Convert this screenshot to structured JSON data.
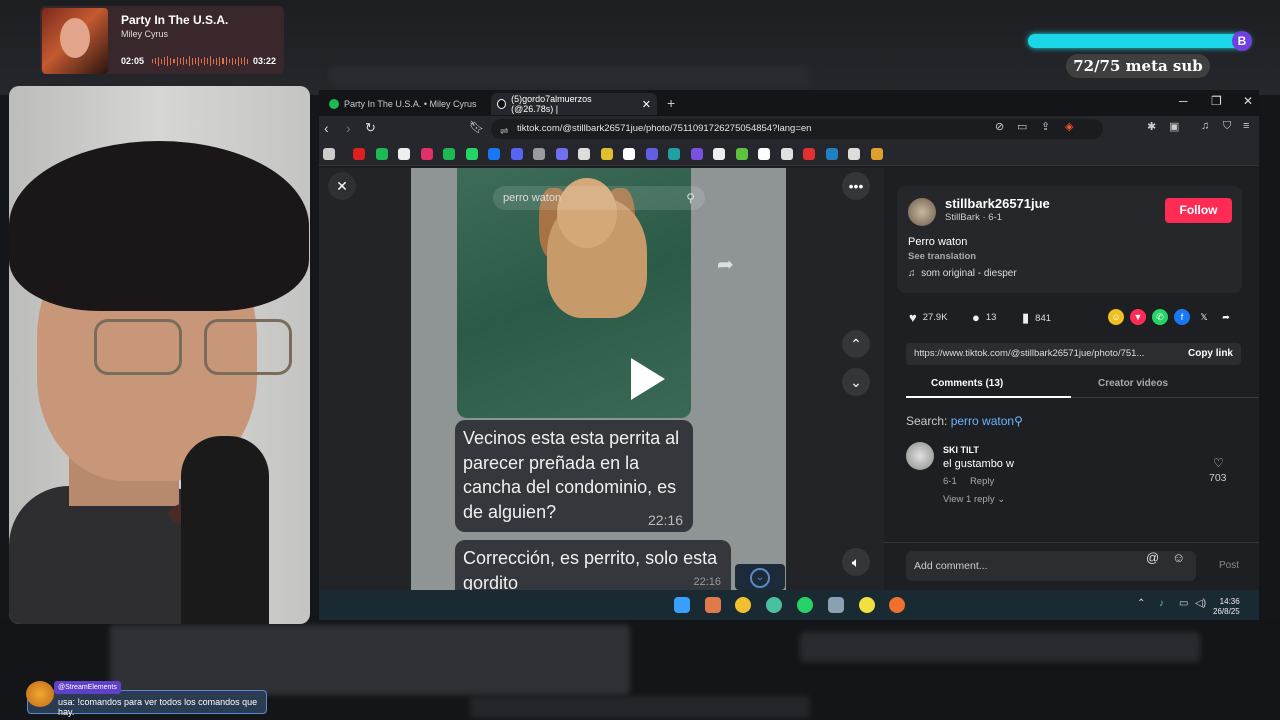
{
  "music": {
    "song": "Party In The U.S.A.",
    "artist": "Miley Cyrus",
    "elapsed": "02:05",
    "duration": "03:22"
  },
  "goal": {
    "label": "72/75 meta sub",
    "badge": "B",
    "progress": 0.96
  },
  "browser": {
    "tabs": [
      {
        "label": "Party In The U.S.A. • Miley Cyrus",
        "active": false
      },
      {
        "label": "(5)gordo7almuerzos (@26.78s) |",
        "active": true
      }
    ],
    "url": "tiktok.com/@stillbark26571jue/photo/7511091726275054854?lang=en"
  },
  "post": {
    "search_overlay": "perro waton",
    "message1": "Vecinos esta esta perrita al parecer preñada en la cancha del condominio, es de alguien?",
    "message1_time": "22:16",
    "message2": "Corrección, es perrito, solo esta gordito",
    "message2_time": "22:16"
  },
  "author": {
    "username": "stillbark26571jue",
    "subtitle": "StillBark · 6-1",
    "follow_label": "Follow",
    "description": "Perro waton",
    "see_translation": "See translation",
    "sound": "som original - diesper"
  },
  "stats": {
    "likes": "27.9K",
    "comments": "13",
    "saves": "841"
  },
  "share": {
    "link": "https://www.tiktok.com/@stillbark26571jue/photo/751...",
    "copy_label": "Copy link"
  },
  "panel_tabs": {
    "comments": "Comments (13)",
    "creator": "Creator videos"
  },
  "search": {
    "prefix": "Search:",
    "term": "perro waton"
  },
  "comment": {
    "user": "SKI TILT",
    "text": "el gustambo w",
    "date": "6-1",
    "reply": "Reply",
    "view_replies": "View 1 reply",
    "likes": "703"
  },
  "add_comment": {
    "placeholder": "Add comment...",
    "post": "Post"
  },
  "taskbar": {
    "time": "14:36",
    "date": "26/8/25"
  },
  "chat": {
    "badge": "@StreamElements",
    "message": "usa: !comandos para ver todos los comandos que hay."
  },
  "colors": {
    "accent": "#fe2c55",
    "goal": "#1ad6e6",
    "link": "#6db4ff"
  }
}
